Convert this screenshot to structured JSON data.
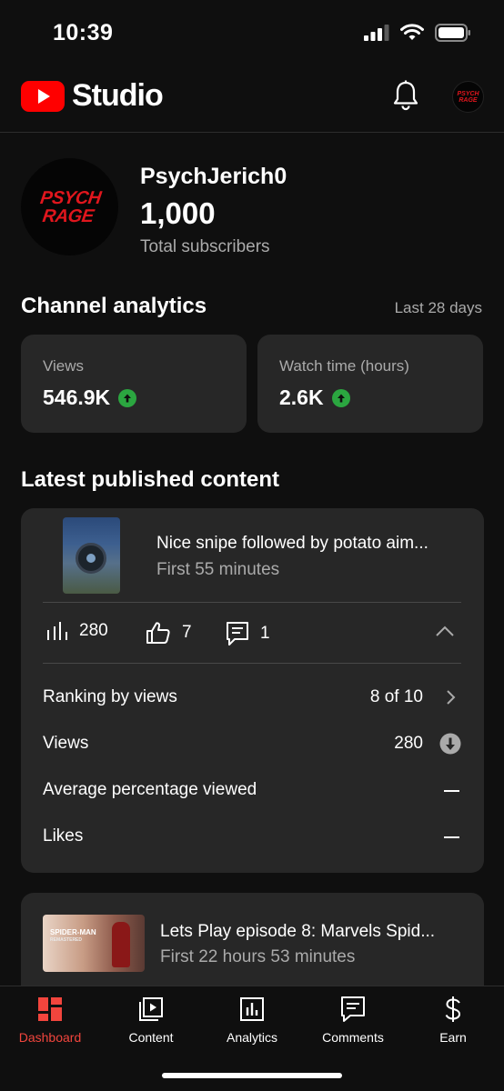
{
  "status_bar": {
    "time": "10:39"
  },
  "header": {
    "app_name": "Studio",
    "avatar_text": "PSYCH RAGE"
  },
  "channel": {
    "logo_text_line1": "PSYCH",
    "logo_text_line2": "RAGE",
    "name": "PsychJerich0",
    "subscriber_count": "1,000",
    "subscriber_label": "Total subscribers"
  },
  "analytics": {
    "title": "Channel analytics",
    "period": "Last 28 days",
    "cards": [
      {
        "label": "Views",
        "value": "546.9K",
        "trend": "up"
      },
      {
        "label": "Watch time (hours)",
        "value": "2.6K",
        "trend": "up"
      }
    ]
  },
  "latest": {
    "title": "Latest published content",
    "videos": [
      {
        "title": "Nice snipe followed by potato aim...",
        "subtitle": "First 55 minutes",
        "views": "280",
        "likes": "7",
        "comments": "1",
        "details": [
          {
            "label": "Ranking by views",
            "value": "8 of 10"
          },
          {
            "label": "Views",
            "value": "280"
          },
          {
            "label": "Average percentage viewed",
            "value": ""
          },
          {
            "label": "Likes",
            "value": ""
          }
        ]
      },
      {
        "title": "Lets Play episode 8: Marvels Spid...",
        "subtitle": "First 22 hours 53 minutes",
        "thumb_text_line1": "SPIDER-MAN",
        "thumb_text_line2": "REMASTERED"
      }
    ]
  },
  "nav": {
    "items": [
      {
        "label": "Dashboard",
        "icon": "dashboard-icon",
        "active": true
      },
      {
        "label": "Content",
        "icon": "content-icon",
        "active": false
      },
      {
        "label": "Analytics",
        "icon": "analytics-icon",
        "active": false
      },
      {
        "label": "Comments",
        "icon": "comments-icon",
        "active": false
      },
      {
        "label": "Earn",
        "icon": "earn-icon",
        "active": false
      }
    ]
  },
  "colors": {
    "accent": "#f2453d",
    "trend_up": "#2ba640",
    "card": "#272727",
    "background": "#0f0f0f"
  }
}
